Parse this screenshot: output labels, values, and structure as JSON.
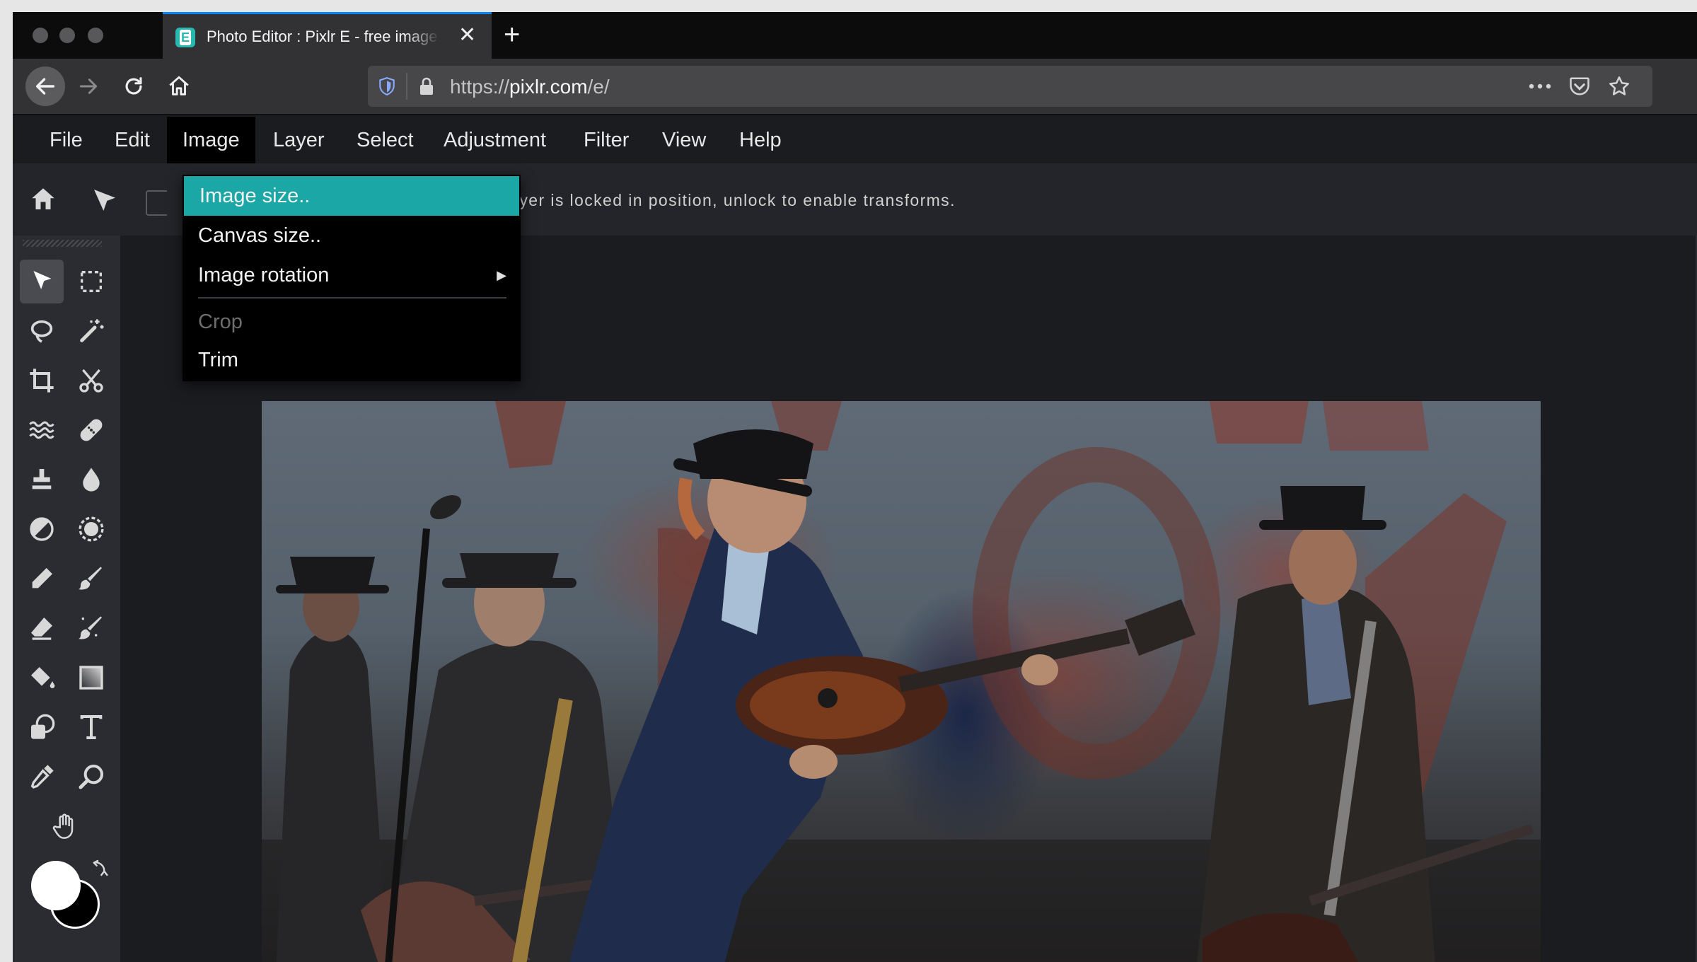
{
  "browser": {
    "tab": {
      "title": "Photo Editor : Pixlr E - free image editor",
      "close_glyph": "✕"
    },
    "new_tab_glyph": "+",
    "url": {
      "scheme": "https://",
      "domain": "pixlr.com",
      "path": "/e/"
    }
  },
  "menubar": {
    "items": [
      "File",
      "Edit",
      "Image",
      "Layer",
      "Select",
      "Adjustment",
      "Filter",
      "View",
      "Help"
    ],
    "active": "Image"
  },
  "image_menu": {
    "items": [
      {
        "label": "Image size..",
        "state": "highlighted"
      },
      {
        "label": "Canvas size..",
        "state": "normal"
      },
      {
        "label": "Image rotation",
        "state": "submenu"
      },
      {
        "label": "Crop",
        "state": "disabled"
      },
      {
        "label": "Trim",
        "state": "normal"
      }
    ],
    "submenu_glyph": "▶"
  },
  "options_bar": {
    "message": "Layer is locked in position, unlock to enable transforms."
  },
  "tools": [
    "arrange-tool-icon",
    "marquee-tool-icon",
    "lasso-tool-icon",
    "wand-tool-icon",
    "crop-tool-icon",
    "cutout-tool-icon",
    "liquify-tool-icon",
    "heal-tool-icon",
    "clone-stamp-tool-icon",
    "blur-tool-icon",
    "dodge-burn-tool-icon",
    "sponge-tool-icon",
    "pencil-tool-icon",
    "brush-tool-icon",
    "eraser-tool-icon",
    "color-replace-tool-icon",
    "fill-tool-icon",
    "gradient-tool-icon",
    "shape-tool-icon",
    "text-tool-icon",
    "eyedropper-tool-icon",
    "zoom-tool-icon",
    "hand-tool-icon"
  ],
  "colors": {
    "foreground": "#ffffff",
    "background": "#000000",
    "accent": "#1aa7a5",
    "tab_indicator": "#0a84ff"
  }
}
